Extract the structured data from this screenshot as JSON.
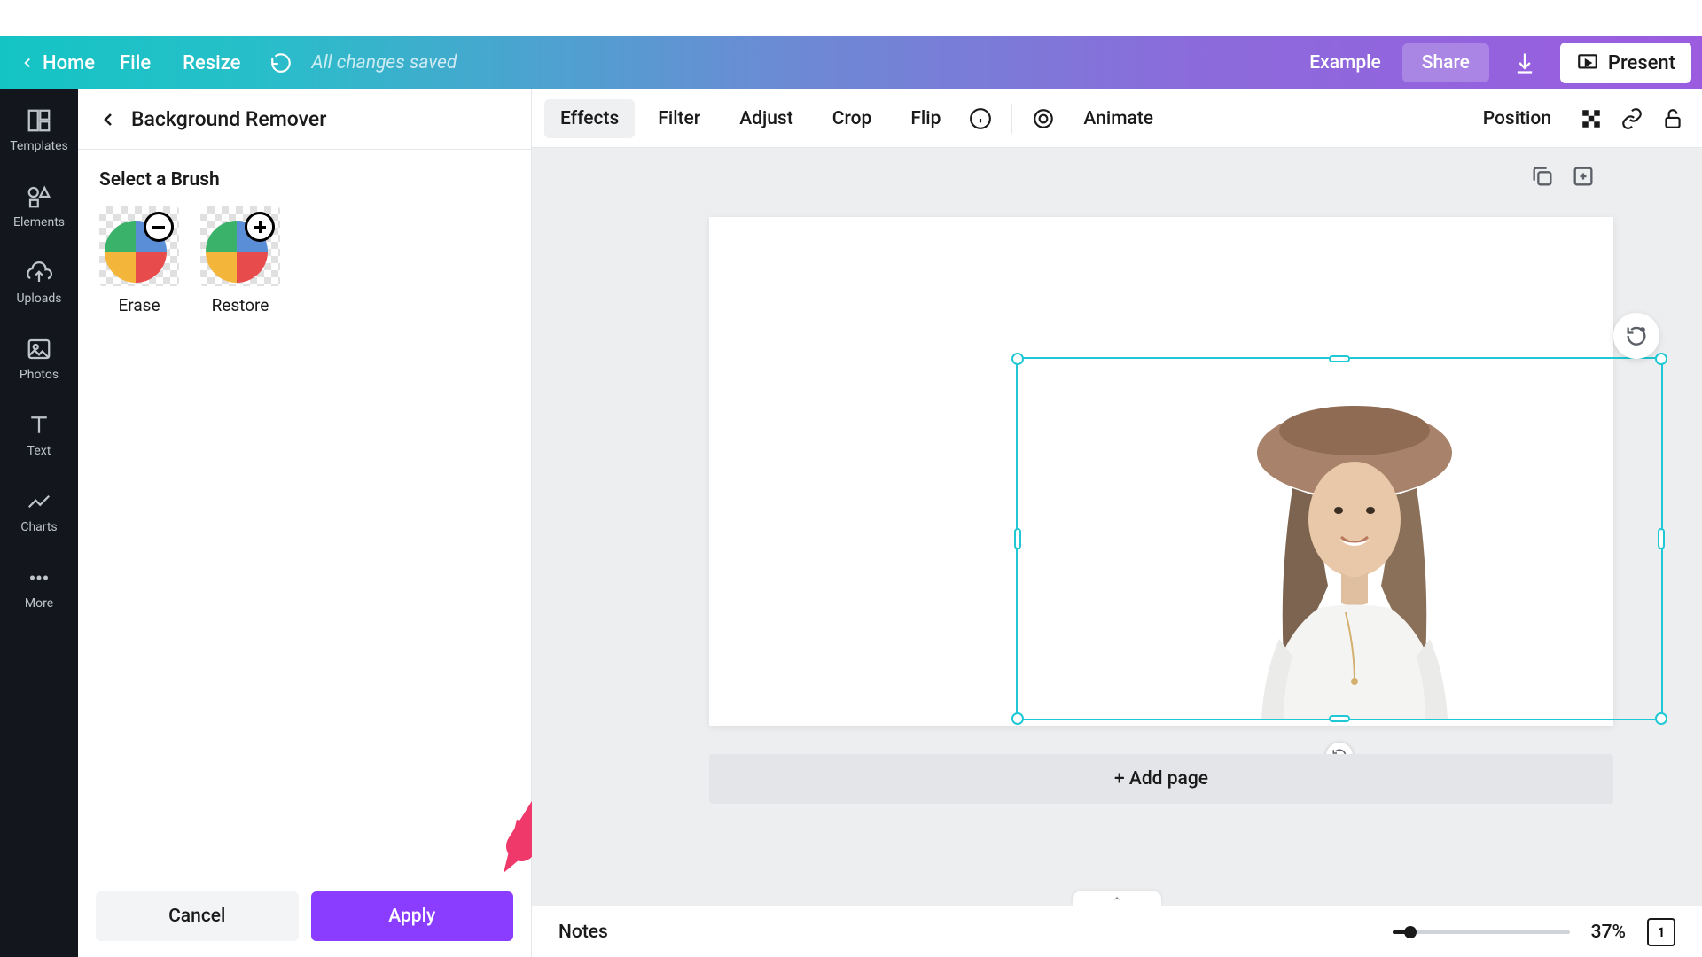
{
  "topbar": {
    "home": "Home",
    "file": "File",
    "resize": "Resize",
    "saved_status": "All changes saved",
    "example": "Example",
    "share": "Share",
    "present": "Present"
  },
  "sidebar": {
    "items": [
      {
        "label": "Templates"
      },
      {
        "label": "Elements"
      },
      {
        "label": "Uploads"
      },
      {
        "label": "Photos"
      },
      {
        "label": "Text"
      },
      {
        "label": "Charts"
      },
      {
        "label": "More"
      }
    ]
  },
  "panel": {
    "title": "Background Remover",
    "brush_heading": "Select a Brush",
    "erase": "Erase",
    "restore": "Restore",
    "cancel": "Cancel",
    "apply": "Apply"
  },
  "toolbar": {
    "effects": "Effects",
    "filter": "Filter",
    "adjust": "Adjust",
    "crop": "Crop",
    "flip": "Flip",
    "animate": "Animate",
    "position": "Position"
  },
  "canvas": {
    "add_page": "+ Add page"
  },
  "bottombar": {
    "notes": "Notes",
    "zoom_pct": "37%",
    "page_num": "1"
  }
}
